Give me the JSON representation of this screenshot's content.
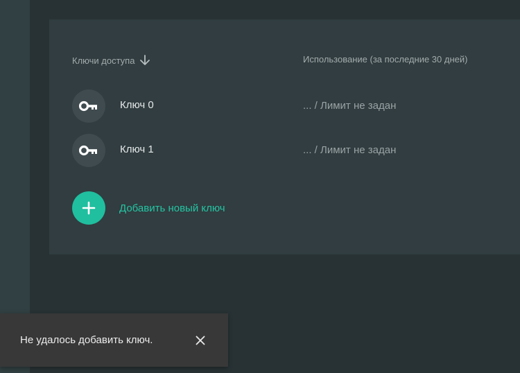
{
  "columns": {
    "keys_label": "Ключи доступа",
    "sort_icon": "arrow-down-icon",
    "usage_label": "Использование (за последние 30 дней)"
  },
  "keys": [
    {
      "name": "Ключ 0",
      "usage": "... / Лимит не задан",
      "icon": "key-icon"
    },
    {
      "name": "Ключ 1",
      "usage": "... / Лимит не задан",
      "icon": "key-icon"
    }
  ],
  "add_key": {
    "label": "Добавить новый ключ",
    "icon": "plus-icon",
    "color": "#1fbf9f"
  },
  "toast": {
    "message": "Не удалось добавить ключ.",
    "close_icon": "close-icon"
  }
}
